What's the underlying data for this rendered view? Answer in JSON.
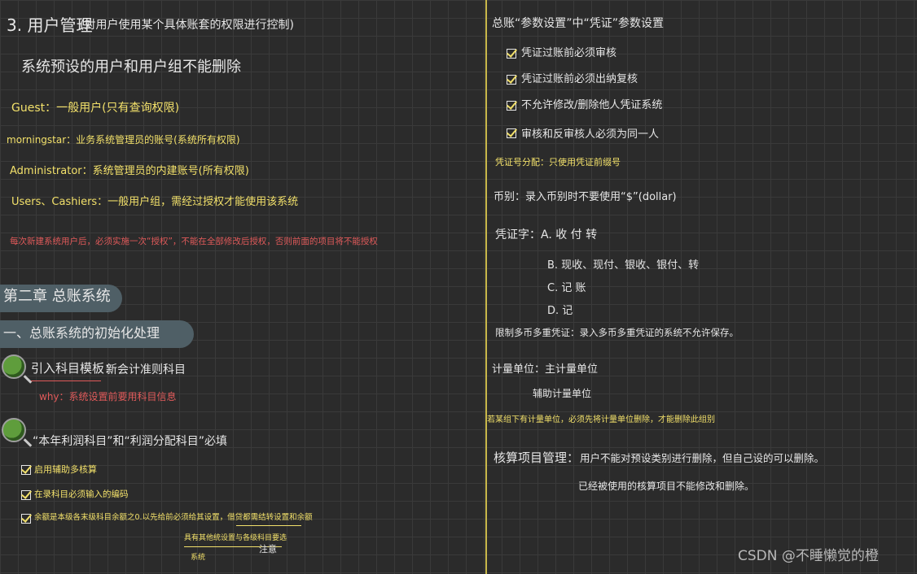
{
  "left": {
    "section3_title": "3. 用户管理",
    "section3_note": "(对用户使用某个具体账套的权限进行控制)",
    "default_users": "系统预设的用户和用户组不能删除",
    "guest": "Guest：一般用户(只有查询权限)",
    "morningstar": "morningstar：业务系统管理员的账号(系统所有权限)",
    "administrator": "Administrator：系统管理员的内建账号(所有权限)",
    "users_cashiers": "Users、Cashiers：一般用户组，需经过授权才能使用该系统",
    "new_user_note": "每次新建系统用户后，必须实施一次“授权”，不能在全部修改后授权，否则前面的项目将不能授权",
    "chapter_title": "第二章 总账系统",
    "subsection_title": "一、总账系统的初始化处理",
    "import_label": "引入科目模板：",
    "import_text": "新会计准则科目",
    "why_text": "why：系统设置前要用科目信息",
    "profit_text": "“本年利润科目”和“利润分配科目”必填",
    "item1": "启用辅助多核算",
    "item2": "在录科目必须输入的编码",
    "item3": "余额是本级各末级科目余额之0.以先给前必须给其设置，借贷都需结转设置和余额",
    "bottom_note1": "具有其他统设置与各级科目要选",
    "bottom_note2": "注意",
    "bottom_note3": "系统"
  },
  "right": {
    "ledger_title": "总账“参数设置”中“凭证”参数设置",
    "check1": "凭证过账前必须审核",
    "check2": "凭证过账前必须出纳复核",
    "check3": "不允许修改/删除他人凭证系统",
    "check4": "审核和反审核人必须为同一人",
    "voucher_number": "凭证号分配：只使用凭证前缀号",
    "currency": "币别：录入币别时不要使用“$”(dollar)",
    "voucher_word": "凭证字：A. 收 付 转",
    "opt_b": "B. 现收、现付、银收、银付、转",
    "opt_c": "C. 记 账",
    "opt_d": "D. 记",
    "limit_note": "限制多币多重凭证：录入多币多重凭证的系统不允许保存。",
    "unit1": "计量单位：主计量单位",
    "unit2": "辅助计量单位",
    "unit_note": "若某组下有计量单位，必须先将计量单位删除，才能删除此组别",
    "audit_label": "核算项目管理：",
    "audit_text1": "用户不能对预设类别进行删除，但自己设的可以删除。",
    "audit_text2": "已经被使用的核算项目不能修改和删除。"
  },
  "watermark": "CSDN @不睡懒觉的橙"
}
